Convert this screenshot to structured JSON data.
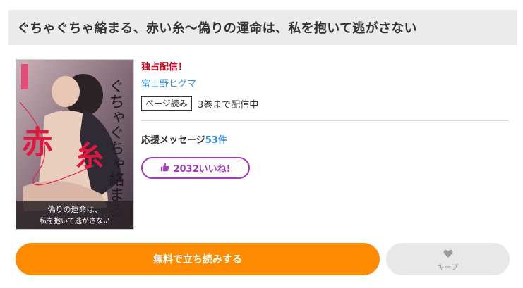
{
  "header": {
    "title": "ぐちゃぐちゃ絡まる、赤い糸～偽りの運命は、私を抱いて逃がさない"
  },
  "book": {
    "exclusive_label": "独占配信！",
    "author": "富士野ヒグマ",
    "read_type": "ページ読み",
    "volumes_text": "3巻まで配信中",
    "support_label": "応援メッセージ",
    "support_count": "53件",
    "like_label": "2032いいね!",
    "cover": {
      "title_red": "赤",
      "title_red2": "糸",
      "title_vertical": "ぐちゃぐちゃ絡まる",
      "subtitle_line1": "偽りの運命は、",
      "subtitle_line2": "私を抱いて逃がさない"
    }
  },
  "actions": {
    "read_free_label": "無料で立ち読みする",
    "keep_label": "キープ"
  },
  "colors": {
    "accent_orange": "#ff8c00",
    "like_purple": "#a13bb8",
    "link_blue": "#3a8fd9",
    "exclusive_red": "#d0021b"
  }
}
